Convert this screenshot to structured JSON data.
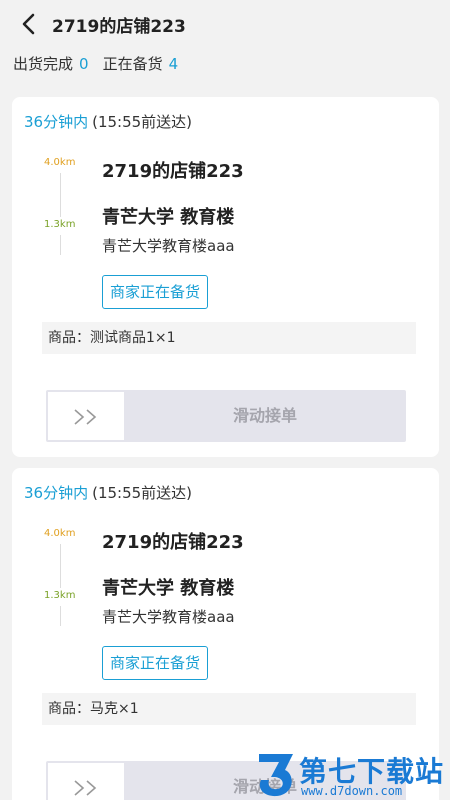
{
  "header": {
    "title": "2719的店铺223"
  },
  "stats": {
    "shipped_label": "出货完成",
    "shipped_count": "0",
    "preparing_label": "正在备货",
    "preparing_count": "4"
  },
  "orders": [
    {
      "time_window": "36分钟内",
      "arrive_by": "(15:55前送达)",
      "shop_distance": "4.0km",
      "shop_name": "2719的店铺223",
      "dest_distance": "1.3km",
      "dest_main": "青芒大学 教育楼",
      "dest_sub": "青芒大学教育楼aaa",
      "status": "商家正在备货",
      "goods": "商品：测试商品1×1",
      "slider_label": "滑动接单"
    },
    {
      "time_window": "36分钟内",
      "arrive_by": "(15:55前送达)",
      "shop_distance": "4.0km",
      "shop_name": "2719的店铺223",
      "dest_distance": "1.3km",
      "dest_main": "青芒大学 教育楼",
      "dest_sub": "青芒大学教育楼aaa",
      "status": "商家正在备货",
      "goods": "商品：马克×1",
      "slider_label": "滑动接单"
    }
  ],
  "watermark": {
    "title": "第七下载站",
    "url": "www.d7down.com"
  },
  "colors": {
    "accent": "#1a9fd4",
    "shop_distance": "#e0a020",
    "dest_distance": "#7aa228",
    "watermark": "#1a7ad4"
  }
}
